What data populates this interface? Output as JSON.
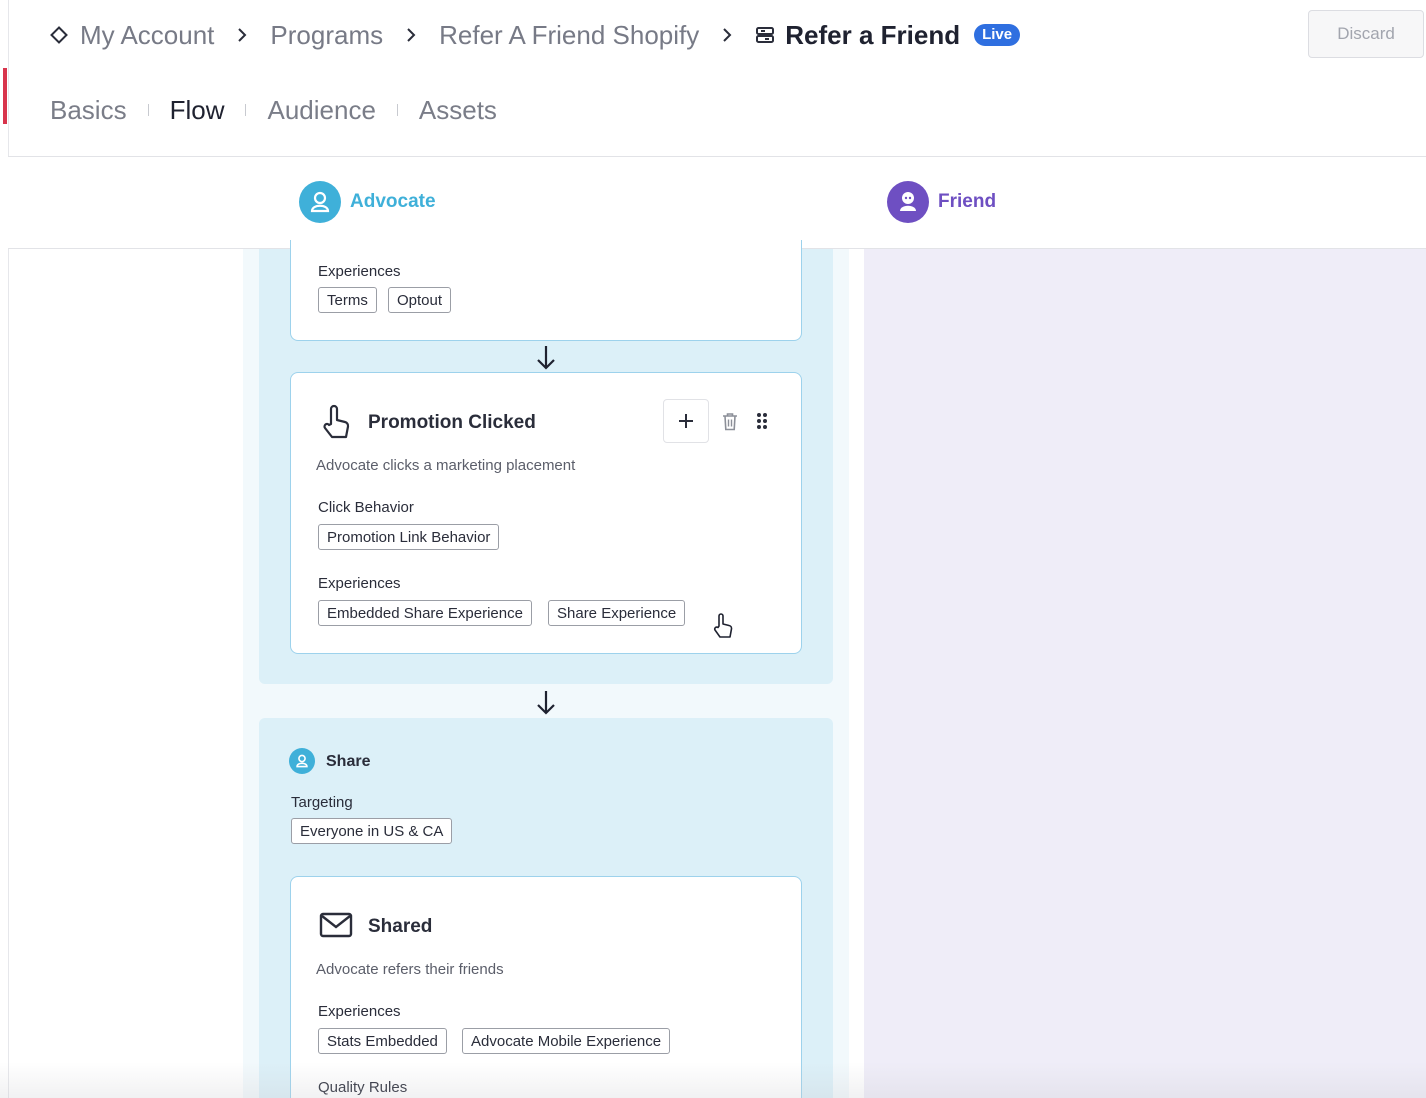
{
  "breadcrumb": {
    "items": [
      {
        "label": "My Account",
        "icon": "diamond-icon"
      },
      {
        "label": "Programs"
      },
      {
        "label": "Refer A Friend Shopify"
      },
      {
        "label": "Refer a Friend",
        "icon": "program-icon"
      }
    ],
    "badge": "Live"
  },
  "actions": {
    "discard_label": "Discard"
  },
  "tabs": [
    {
      "label": "Basics"
    },
    {
      "label": "Flow",
      "active": true
    },
    {
      "label": "Audience"
    },
    {
      "label": "Assets"
    }
  ],
  "lanes": {
    "advocate": {
      "label": "Advocate",
      "color": "#3fb0d9",
      "icon": "advocate-avatar-icon"
    },
    "friend": {
      "label": "Friend",
      "color": "#6e4fc2",
      "icon": "friend-avatar-icon"
    }
  },
  "flow": {
    "top_card": {
      "experiences_label": "Experiences",
      "experiences": [
        "Terms",
        "Optout"
      ]
    },
    "promotion_card": {
      "title": "Promotion Clicked",
      "icon": "pointer-hand-icon",
      "description": "Advocate clicks a marketing placement",
      "click_behavior_label": "Click Behavior",
      "click_behavior": [
        "Promotion Link Behavior"
      ],
      "experiences_label": "Experiences",
      "experiences": [
        "Embedded Share Experience",
        "Share Experience"
      ]
    },
    "share_stage": {
      "title": "Share",
      "targeting_label": "Targeting",
      "targeting": [
        "Everyone in US & CA"
      ]
    },
    "shared_card": {
      "title": "Shared",
      "icon": "envelope-icon",
      "description": "Advocate refers their friends",
      "experiences_label": "Experiences",
      "experiences": [
        "Stats Embedded",
        "Advocate Mobile Experience"
      ],
      "quality_rules_label": "Quality Rules"
    }
  }
}
